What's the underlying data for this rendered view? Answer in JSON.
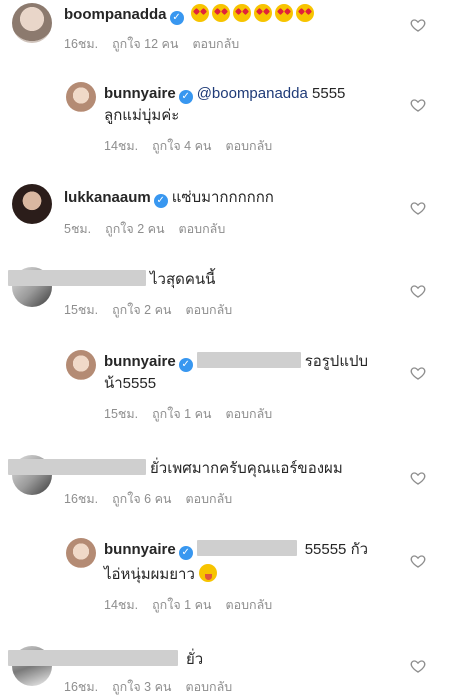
{
  "comments": [
    {
      "username": "boompanadda",
      "text": "",
      "emojis": [
        "heart-eyes-emoji",
        "heart-eyes-emoji",
        "heart-eyes-emoji",
        "heart-eyes-emoji",
        "heart-eyes-emoji",
        "heart-eyes-emoji"
      ],
      "time": "16ชม.",
      "likes": "ถูกใจ 12 คน",
      "reply": "ตอบกลับ"
    },
    {
      "username": "bunnyaire",
      "mention": "@boompanadda",
      "text_line1": " 5555",
      "text_line2": "ลูกแม่บุ่มค่ะ",
      "time": "14ชม.",
      "likes": "ถูกใจ 4 คน",
      "reply": "ตอบกลับ"
    },
    {
      "username": "lukkanaaum",
      "text": "แซ่บมากกกกกก",
      "time": "5ชม.",
      "likes": "ถูกใจ 2 คน",
      "reply": "ตอบกลับ"
    },
    {
      "text": "ไวสุดคนนี้",
      "time": "15ชม.",
      "likes": "ถูกใจ 2 คน",
      "reply": "ตอบกลับ"
    },
    {
      "username": "bunnyaire",
      "text_line1": "รอรูปแปบ",
      "text_line2": "น้า5555",
      "time": "15ชม.",
      "likes": "ถูกใจ 1 คน",
      "reply": "ตอบกลับ"
    },
    {
      "text": "ยั่วเพศมากครับคุณแอร์ของผม",
      "time": "16ชม.",
      "likes": "ถูกใจ 6 คน",
      "reply": "ตอบกลับ"
    },
    {
      "username": "bunnyaire",
      "text_line1": "55555 กัว",
      "text_line2": "ไอ่หนุ่มผมยาว",
      "time": "14ชม.",
      "likes": "ถูกใจ 1 คน",
      "reply": "ตอบกลับ"
    },
    {
      "text": "ยั่ว",
      "time": "16ชม.",
      "likes": "ถูกใจ 3 คน",
      "reply": "ตอบกลับ"
    }
  ],
  "icons": {
    "like": "heart-outline-icon",
    "verified": "verified-badge-icon"
  },
  "colors": {
    "text": "#262626",
    "meta": "#8e8e8e",
    "verified": "#3897f0",
    "mention": "#1f3b78"
  }
}
